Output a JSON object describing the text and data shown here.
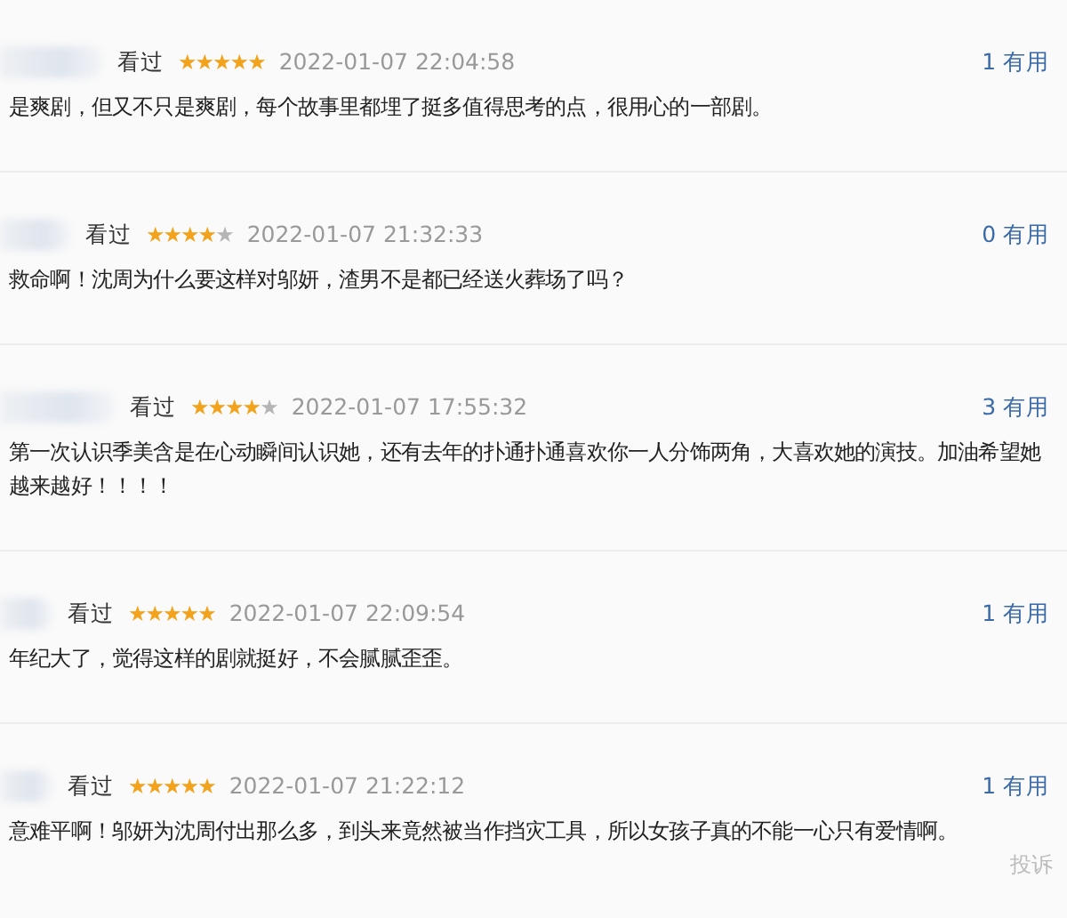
{
  "reviews": [
    {
      "status": "看过",
      "stars": 5,
      "time": "2022-01-07 22:04:58",
      "votes": "1",
      "vote_label": "有用",
      "text": "是爽剧，但又不只是爽剧，每个故事里都埋了挺多值得思考的点，很用心的一部剧。"
    },
    {
      "status": "看过",
      "stars": 4,
      "time": "2022-01-07 21:32:33",
      "votes": "0",
      "vote_label": "有用",
      "text": "救命啊！沈周为什么要这样对邬妍，渣男不是都已经送火葬场了吗？"
    },
    {
      "status": "看过",
      "stars": 4,
      "time": "2022-01-07 17:55:32",
      "votes": "3",
      "vote_label": "有用",
      "text": "第一次认识季美含是在心动瞬间认识她，还有去年的扑通扑通喜欢你一人分饰两角，大喜欢她的演技。加油希望她越来越好！！！！"
    },
    {
      "status": "看过",
      "stars": 5,
      "time": "2022-01-07 22:09:54",
      "votes": "1",
      "vote_label": "有用",
      "text": "年纪大了，觉得这样的剧就挺好，不会腻腻歪歪。"
    },
    {
      "status": "看过",
      "stars": 5,
      "time": "2022-01-07 21:22:12",
      "votes": "1",
      "vote_label": "有用",
      "text": "意难平啊！邬妍为沈周付出那么多，到头来竟然被当作挡灾工具，所以女孩子真的不能一心只有爱情啊。"
    }
  ],
  "report": "投诉"
}
